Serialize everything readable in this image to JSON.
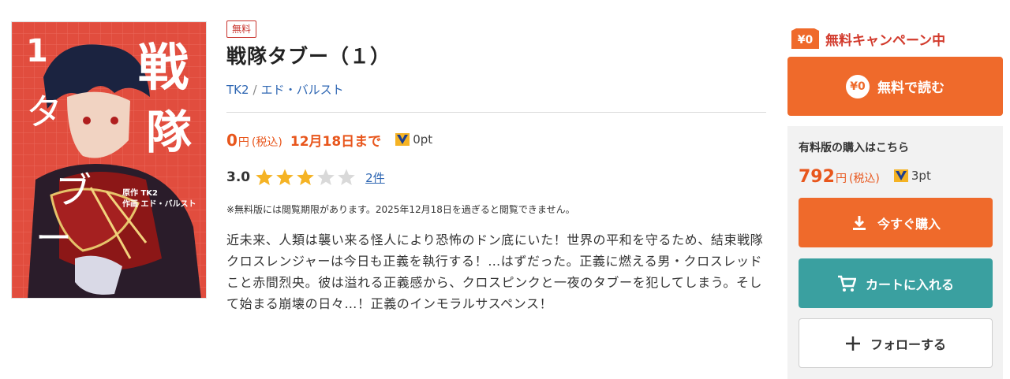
{
  "book": {
    "cover": {
      "title_text": "戦隊タブー",
      "volume_number": "1",
      "credit_line1": "原作 TK2",
      "credit_line2": "作画 エド・バルスト"
    },
    "free_badge": "無料",
    "title": "戦隊タブー（１）",
    "authors": [
      "TK2",
      "エド・バルスト"
    ],
    "author_separator": "/",
    "price": {
      "amount": "0",
      "unit": "円",
      "tax_note": "(税込)",
      "deadline": "12月18日まで",
      "points": "0pt"
    },
    "rating": {
      "score": "3.0",
      "stars_filled": 3,
      "stars_total": 5,
      "count": "2件"
    },
    "notice": "※無料版には閲覧期限があります。2025年12月18日を過ぎると閲覧できません。",
    "synopsis": "近未来、人類は襲い来る怪人により恐怖のドン底にいた！世界の平和を守るため、結束戦隊クロスレンジャーは今日も正義を執行する！…はずだった。正義に燃える男・クロスレッドこと赤間烈央。彼は溢れる正義感から、クロスピンクと一夜のタブーを犯してしまう。そして始まる崩壊の日々…！正義のインモラルサスペンス！"
  },
  "sidebar": {
    "campaign_icon_text": "¥0",
    "campaign_label": "無料キャンペーン中",
    "free_read_icon_text": "¥0",
    "free_read_label": "無料で読む",
    "paid_title": "有料版の購入はこちら",
    "paid_price": {
      "amount": "792",
      "unit": "円",
      "tax_note": "(税込)",
      "points": "3pt"
    },
    "buy_label": "今すぐ購入",
    "cart_label": "カートに入れる",
    "follow_label": "フォローする"
  },
  "colors": {
    "accent_orange": "#ef6a2b",
    "price_orange": "#e8561c",
    "campaign_red": "#d23a2c",
    "cart_teal": "#3aa0a0",
    "link_blue": "#2f67b3",
    "star_gold": "#f5b324",
    "star_empty": "#d9d9d9"
  },
  "icons": {
    "points": "point-v-icon",
    "star": "star-icon",
    "download": "download-icon",
    "cart": "cart-icon",
    "plus": "plus-icon"
  }
}
